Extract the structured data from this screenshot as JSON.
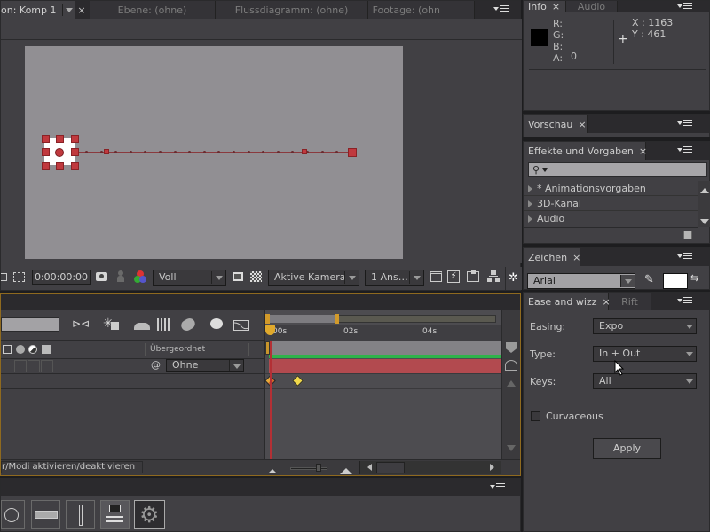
{
  "composition_panel": {
    "tabs": [
      {
        "label": "on: Komp 1",
        "active": true
      },
      {
        "label": "Ebene: (ohne)",
        "active": false
      },
      {
        "label": "Flussdiagramm: (ohne)",
        "active": false
      },
      {
        "label": "Footage: (ohn",
        "active": false
      }
    ],
    "close_glyph": "×",
    "toolbar": {
      "timecode": "0:00:00:00",
      "resolution": "Voll",
      "camera": "Aktive Kamera",
      "views": "1 Ans…"
    }
  },
  "info_panel": {
    "tabs": [
      {
        "label": "Info",
        "active": true
      },
      {
        "label": "Audio",
        "active": false
      }
    ],
    "channels": {
      "R": "R:",
      "G": "G:",
      "B": "B:",
      "A": "A:"
    },
    "alpha_value": "0",
    "swatch_color": "#000000",
    "x_label": "X :",
    "x_value": "1163",
    "y_label": "Y :",
    "y_value": "461"
  },
  "preview_panel": {
    "tab": "Vorschau"
  },
  "effects_panel": {
    "tab": "Effekte und Vorgaben",
    "search_placeholder": "",
    "items": [
      {
        "label": "* Animationsvorgaben"
      },
      {
        "label": "3D-Kanal"
      },
      {
        "label": "Audio"
      }
    ]
  },
  "character_panel": {
    "tab": "Zeichen",
    "font": "Arial",
    "fill_color": "#ffffff"
  },
  "ease_panel": {
    "tabs": [
      {
        "label": "Ease and wizz",
        "active": true
      },
      {
        "label": "Rift",
        "active": false
      }
    ],
    "easing_label": "Easing:",
    "easing_value": "Expo",
    "type_label": "Type:",
    "type_value": "In + Out",
    "keys_label": "Keys:",
    "keys_value": "All",
    "curvaceous_label": "Curvaceous",
    "curvaceous_checked": false,
    "apply_label": "Apply"
  },
  "timeline": {
    "search_value": "",
    "parent_header": "Übergeordnet",
    "parent_value": "Ohne",
    "ruler_labels": [
      "00s",
      "02s",
      "04s",
      "0"
    ],
    "keyframes_seconds": [
      0,
      0.7
    ],
    "status_text": "r/Modi aktivieren/deaktivieren",
    "colors": {
      "work_area": "#c0393e",
      "layer_bar": "#b24a4f",
      "green_bar": "#2fb34a",
      "playhead": "#e0a92c"
    }
  },
  "bottom_panel": {
    "buttons": [
      "timer-icon",
      "dropdown-widget-icon",
      "slider-widget-icon",
      "list-widget-icon",
      "gear-icon"
    ]
  }
}
